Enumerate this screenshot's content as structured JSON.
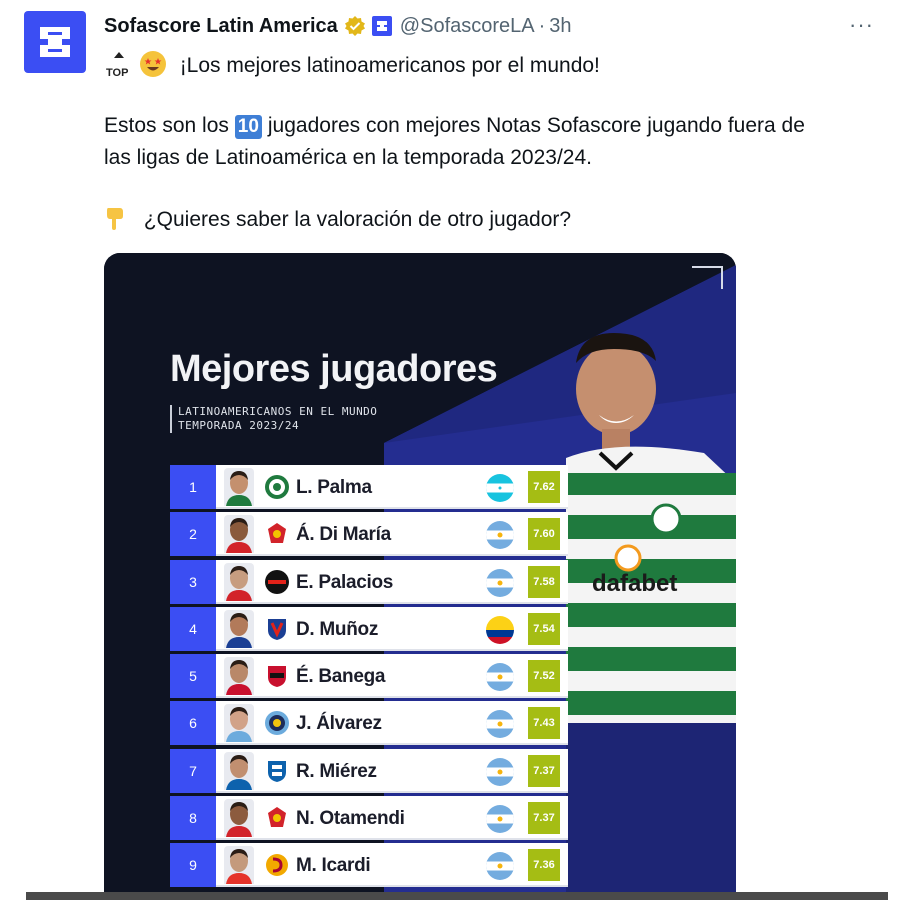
{
  "tweet": {
    "display_name": "Sofascore Latin America",
    "handle": "@SofascoreLA",
    "separator": "·",
    "time": "3h",
    "more": "···",
    "top_badge": "TOP",
    "line1": "¡Los mejores latinoamericanos por el mundo!",
    "line2_prefix": "Estos son los",
    "line2_badge": "10",
    "line2_suffix": "jugadores con mejores Notas Sofascore jugando fuera de",
    "line3": "las ligas de Latinoamérica en la temporada 2023/24.",
    "line4": "¿Quieres saber la valoración de otro jugador?",
    "accent_color": "#3b4ef3"
  },
  "card": {
    "title": "Mejores jugadores",
    "subtitle_line1": "LATINOAMERICANOS EN EL MUNDO",
    "subtitle_line2": "TEMPORADA 2023/24",
    "rating_color": "#a5bd14",
    "rows": [
      {
        "rank": "1",
        "name": "L. Palma",
        "rating": "7.62",
        "club_icon": "celtic-crest",
        "flag": "honduras"
      },
      {
        "rank": "2",
        "name": "Á. Di María",
        "rating": "7.60",
        "club_icon": "benfica-crest",
        "flag": "argentina"
      },
      {
        "rank": "3",
        "name": "E. Palacios",
        "rating": "7.58",
        "club_icon": "leverkusen-crest",
        "flag": "argentina"
      },
      {
        "rank": "4",
        "name": "D. Muñoz",
        "rating": "7.54",
        "club_icon": "crystal-palace-crest",
        "flag": "colombia"
      },
      {
        "rank": "5",
        "name": "É. Banega",
        "rating": "7.52",
        "club_icon": "neom-crest",
        "flag": "argentina"
      },
      {
        "rank": "6",
        "name": "J. Álvarez",
        "rating": "7.43",
        "club_icon": "man-city-crest",
        "flag": "argentina"
      },
      {
        "rank": "7",
        "name": "R. Miérez",
        "rating": "7.37",
        "club_icon": "zaragoza-crest",
        "flag": "argentina"
      },
      {
        "rank": "8",
        "name": "N. Otamendi",
        "rating": "7.37",
        "club_icon": "benfica-crest",
        "flag": "argentina"
      },
      {
        "rank": "9",
        "name": "M. Icardi",
        "rating": "7.36",
        "club_icon": "galatasaray-crest",
        "flag": "argentina"
      }
    ],
    "featured_player_sponsor": "dafabet"
  }
}
